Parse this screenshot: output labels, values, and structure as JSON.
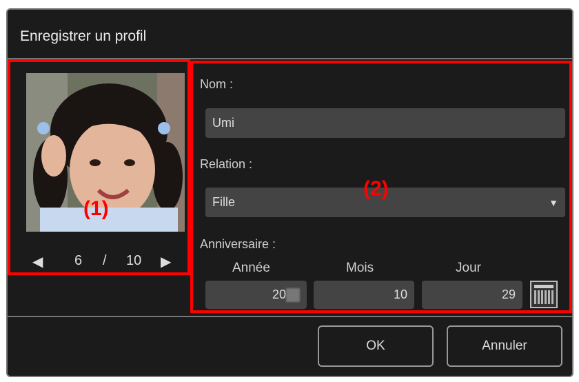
{
  "dialog": {
    "title": "Enregistrer un profil"
  },
  "photo_pane": {
    "current": "6",
    "separator": "/",
    "total": "10",
    "prev_icon": "left-arrow-icon",
    "next_icon": "right-arrow-icon"
  },
  "form": {
    "name_label": "Nom :",
    "name_value": "Umi",
    "relation_label": "Relation :",
    "relation_value": "Fille",
    "birthday_label": "Anniversaire :",
    "year_label": "Année",
    "month_label": "Mois",
    "day_label": "Jour",
    "year_value": "20",
    "month_value": "10",
    "day_value": "29",
    "calendar_icon": "calendar-icon"
  },
  "buttons": {
    "ok": "OK",
    "cancel": "Annuler"
  },
  "annotations": {
    "a1": "(1)",
    "a2": "(2)"
  },
  "colors": {
    "annotation": "#ff0000",
    "background": "#1b1b1b",
    "field": "#444444"
  }
}
